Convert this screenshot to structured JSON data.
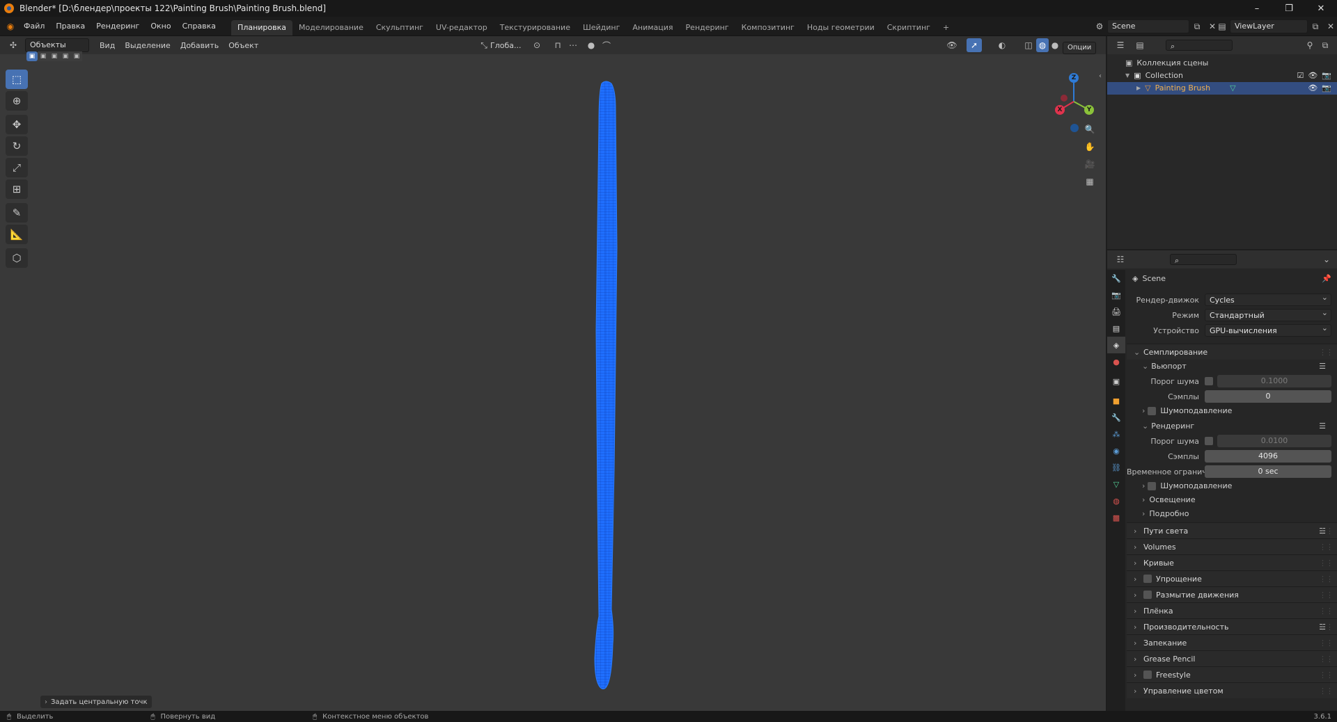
{
  "titlebar": {
    "title": "Blender* [D:\\блендер\\проекты 122\\Painting Brush\\Painting Brush.blend]",
    "minimize": "–",
    "maximize": "❐",
    "close": "✕"
  },
  "menu": [
    "Файл",
    "Правка",
    "Рендеринг",
    "Окно",
    "Справка"
  ],
  "workspaces": [
    "Планировка",
    "Моделирование",
    "Скульптинг",
    "UV-редактор",
    "Текстурирование",
    "Шейдинг",
    "Анимация",
    "Рендеринг",
    "Композитинг",
    "Ноды геометрии",
    "Скриптинг"
  ],
  "workspace_add": "+",
  "scene_name": "Scene",
  "view_layer": "ViewLayer",
  "viewport": {
    "mode": "Объекты",
    "menus": [
      "Вид",
      "Выделение",
      "Добавить",
      "Объект"
    ],
    "orientation": "Глоба...",
    "options_label": "Опции",
    "gizmo": {
      "z": "Z",
      "y": "Y",
      "x": "X"
    },
    "last_op": "Задать центральную точк",
    "object_color": "#1f6fff"
  },
  "outliner": {
    "root": "Коллекция сцены",
    "collection": "Collection",
    "object": "Painting Brush"
  },
  "properties": {
    "context_name": "Scene",
    "fields": [
      {
        "label": "Рендер-движок",
        "value": "Cycles"
      },
      {
        "label": "Режим",
        "value": "Стандартный"
      },
      {
        "label": "Устройство",
        "value": "GPU-вычисления"
      }
    ],
    "sampling": {
      "label": "Семплирование",
      "viewport": {
        "label": "Вьюпорт",
        "noise_label": "Порог шума",
        "noise_value": "0.1000",
        "samples_label": "Сэмплы",
        "samples_value": "0",
        "denoise": "Шумоподавление"
      },
      "render": {
        "label": "Рендеринг",
        "noise_label": "Порог шума",
        "noise_value": "0.0100",
        "samples_label": "Сэмплы",
        "samples_value": "4096",
        "time_label": "Временное огранич...",
        "time_value": "0 sec",
        "denoise": "Шумоподавление",
        "lights": "Освещение",
        "advanced": "Подробно"
      }
    },
    "panels": [
      "Пути света",
      "Volumes",
      "Кривые",
      "Упрощение",
      "Размытие движения",
      "Плёнка",
      "Производительность",
      "Запекание",
      "Grease Pencil",
      "Freestyle",
      "Управление цветом"
    ]
  },
  "status": {
    "select": "Выделить",
    "rotate": "Повернуть вид",
    "context": "Контекстное меню объектов",
    "version": "3.6.1"
  }
}
